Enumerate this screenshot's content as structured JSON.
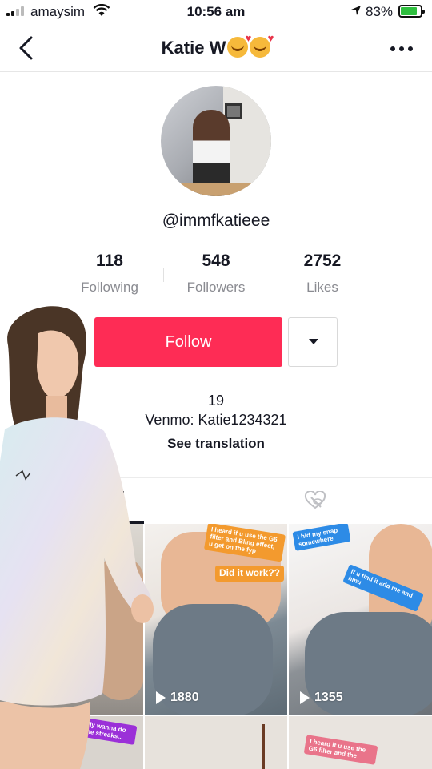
{
  "status_bar": {
    "carrier": "amaysim",
    "time": "10:56 am",
    "battery": "83%",
    "battery_level": 0.83
  },
  "nav": {
    "title": "Katie W",
    "title_emoji": "smiling-face-with-hearts",
    "back_icon": "chevron-left-icon",
    "more_icon": "more-horizontal-icon"
  },
  "profile": {
    "handle": "@immfkatieee",
    "stats": [
      {
        "value": "118",
        "label": "Following"
      },
      {
        "value": "548",
        "label": "Followers"
      },
      {
        "value": "2752",
        "label": "Likes"
      }
    ],
    "follow_label": "Follow",
    "bio_line1": "19",
    "bio_line2": "Venmo: Katie1234321",
    "see_translation": "See translation"
  },
  "tabs": {
    "videos_icon": "grid-bars-icon",
    "liked_icon": "heart-hidden-icon"
  },
  "videos": [
    {
      "views": "",
      "captions": []
    },
    {
      "views": "1880",
      "captions": [
        "I heard if u use the G6 filter and Bling effect, u get on the fyp",
        "Did it work??"
      ]
    },
    {
      "views": "1355",
      "captions": [
        "I hid my snap somewhere",
        "If u find it add me and hmu"
      ]
    },
    {
      "views": "",
      "captions": [
        "really wanna do some streaks..."
      ]
    },
    {
      "views": "",
      "captions": []
    },
    {
      "views": "",
      "captions": [
        "I heard if u use the G6 filter and the"
      ]
    }
  ],
  "colors": {
    "follow_button": "#fe2c55",
    "caption_orange": "#f39a2e",
    "caption_blue": "#2d8be6",
    "caption_purple": "#9b30d8",
    "battery_green": "#2fbf3f"
  }
}
